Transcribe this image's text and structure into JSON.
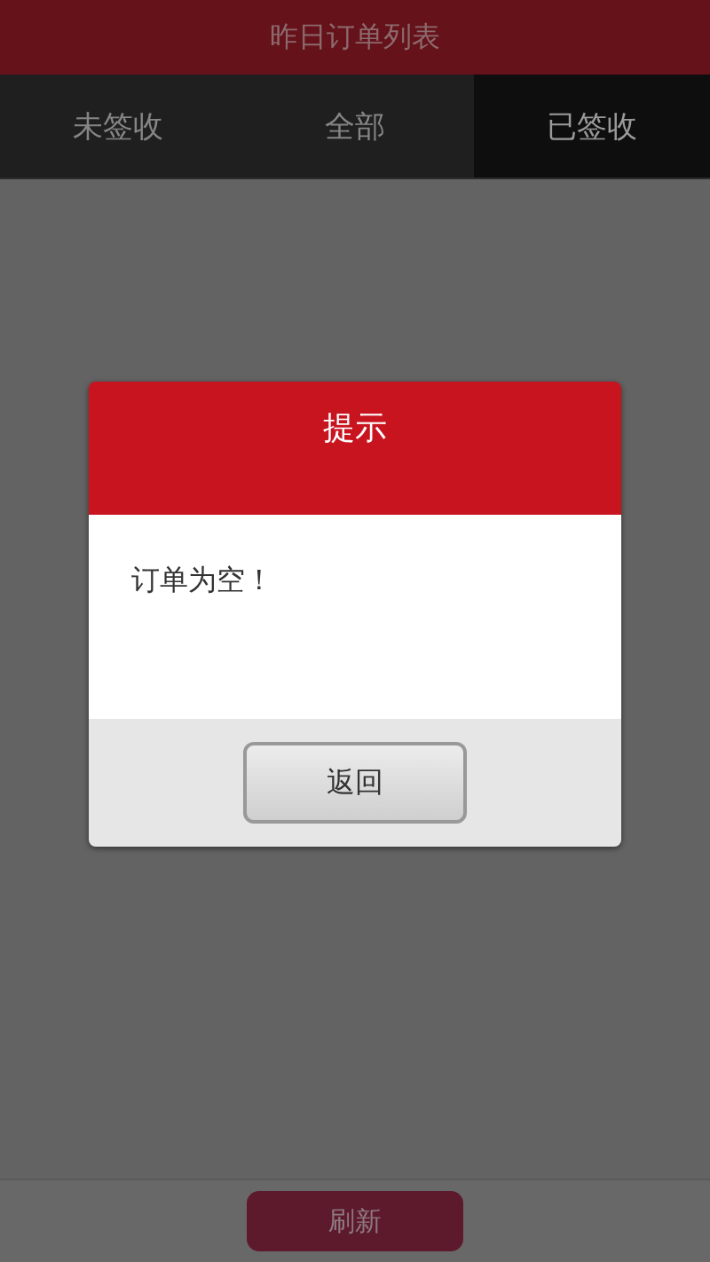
{
  "header": {
    "title": "昨日订单列表"
  },
  "tabs": [
    {
      "label": "未签收",
      "selected": false
    },
    {
      "label": "全部",
      "selected": false
    },
    {
      "label": "已签收",
      "selected": true
    }
  ],
  "bottom_bar": {
    "button": "刷新"
  },
  "dialog": {
    "title": "提示",
    "message": "订单为空！",
    "button": "返回"
  }
}
